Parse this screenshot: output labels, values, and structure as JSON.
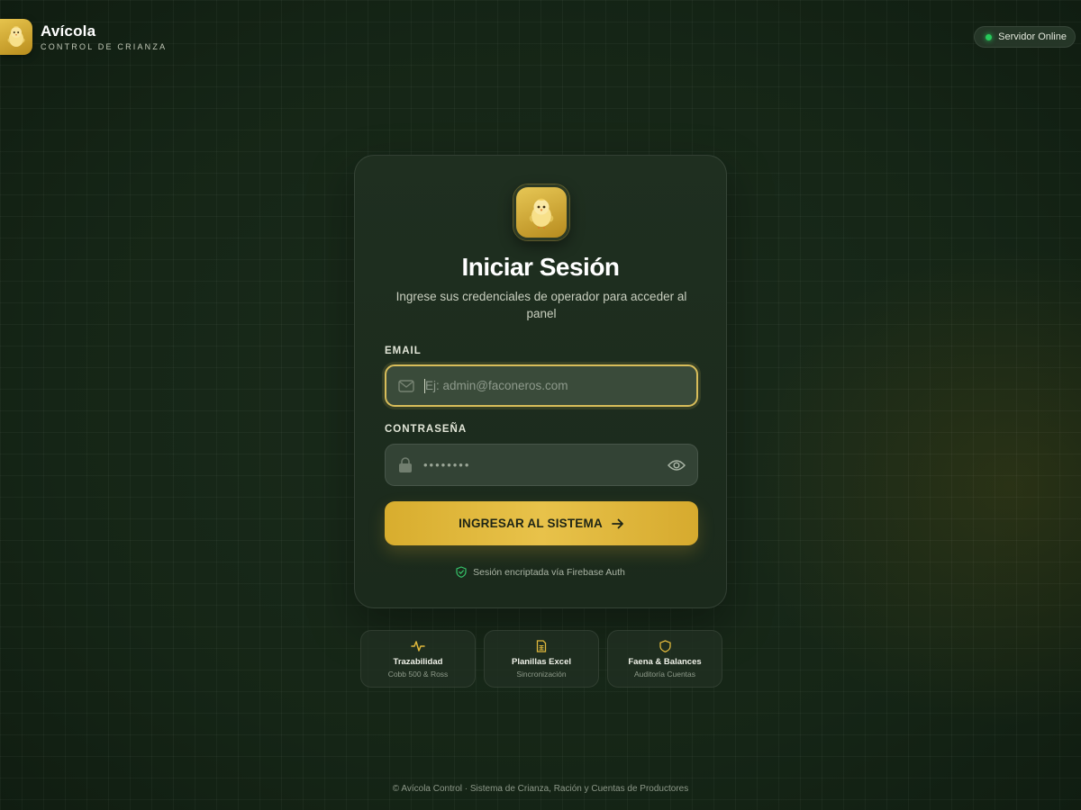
{
  "header": {
    "brand_title": "Avícola",
    "brand_subtitle": "CONTROL DE CRIANZA",
    "status_text": "Servidor Online",
    "status_color": "#27c95a"
  },
  "login": {
    "title": "Iniciar Sesión",
    "subtitle": "Ingrese sus credenciales de operador para acceder al panel",
    "email_label": "EMAIL",
    "email_placeholder": "Ej: admin@faconeros.com",
    "email_value": "",
    "password_label": "CONTRASEÑA",
    "password_mask": "••••••••",
    "submit_label": "INGRESAR AL SISTEMA",
    "secure_note": "Sesión encriptada vía Firebase Auth",
    "icons": {
      "logo": "chick-icon",
      "email": "mail-icon",
      "password": "lock-icon",
      "toggle": "eye-icon",
      "submit": "arrow-right-icon",
      "secure": "shield-check-icon"
    }
  },
  "features": [
    {
      "title": "Trazabilidad",
      "subtitle": "Cobb 500 & Ross",
      "icon": "activity-icon"
    },
    {
      "title": "Planillas Excel",
      "subtitle": "Sincronización",
      "icon": "spreadsheet-icon"
    },
    {
      "title": "Faena & Balances",
      "subtitle": "Auditoría Cuentas",
      "icon": "shield-icon"
    }
  ],
  "footer": {
    "text": "© Avícola Control · Sistema de Crianza, Ración y Cuentas de Productores"
  },
  "colors": {
    "accent": "#e0b83c",
    "background": "#152516",
    "card": "#1d2c1e"
  }
}
